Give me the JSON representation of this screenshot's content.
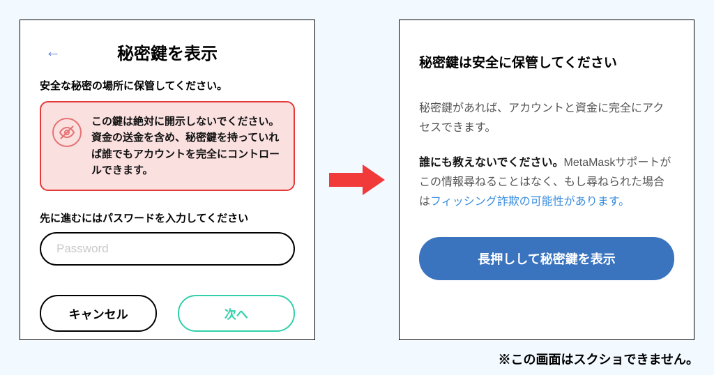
{
  "panel1": {
    "title": "秘密鍵を表示",
    "subtitle": "安全な秘密の場所に保管してください。",
    "warning_text": "この鍵は絶対に開示しないでください。資金の送金を含め、秘密鍵を持っていれば誰でもアカウントを完全にコントロールできます。",
    "password_label": "先に進むにはパスワードを入力してください",
    "password_placeholder": "Password",
    "cancel_label": "キャンセル",
    "next_label": "次へ"
  },
  "panel2": {
    "title": "秘密鍵は安全に保管してください",
    "desc1": "秘密鍵があれば、アカウントと資金に完全にアクセスできます。",
    "strong_lead": "誰にも教えないでください。",
    "desc2a": "MetaMaskサポートがこの情報尋ねることはなく、もし尋ねられた場合は",
    "phishing_link": "フィッシング詐欺の可能性があります。",
    "reveal_button": "長押しして秘密鍵を表示"
  },
  "footnote": "※この画面はスクショできません。"
}
